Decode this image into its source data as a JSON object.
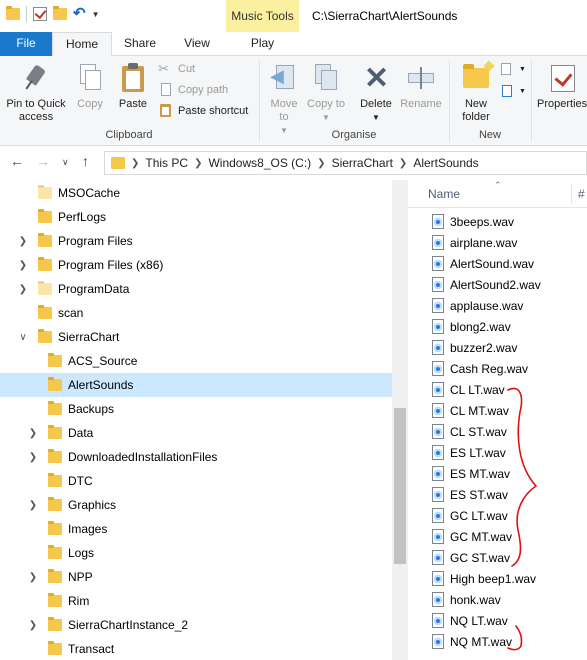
{
  "titlebar": {
    "contextual_tab": "Music Tools",
    "path": "C:\\SierraChart\\AlertSounds",
    "quick_access": [
      "folder-icon",
      "properties-check-icon",
      "folder-icon",
      "undo-icon",
      "customize-dropdown-icon"
    ]
  },
  "tabs": [
    {
      "label": "File"
    },
    {
      "label": "Home"
    },
    {
      "label": "Share"
    },
    {
      "label": "View"
    },
    {
      "label": "Play"
    }
  ],
  "ribbon": {
    "clipboard": {
      "pin_label": "Pin to Quick access",
      "copy_label": "Copy",
      "paste_label": "Paste",
      "cut_label": "Cut",
      "copy_path_label": "Copy path",
      "paste_shortcut_label": "Paste shortcut",
      "group_label": "Clipboard"
    },
    "organise": {
      "move_to_label": "Move to",
      "copy_to_label": "Copy to",
      "delete_label": "Delete",
      "rename_label": "Rename",
      "group_label": "Organise"
    },
    "new": {
      "new_folder_label": "New folder",
      "group_label": "New"
    },
    "open": {
      "properties_label": "Properties"
    }
  },
  "address": {
    "crumbs": [
      "This PC",
      "Windows8_OS (C:)",
      "SierraChart",
      "AlertSounds"
    ]
  },
  "tree": [
    {
      "label": "MSOCache",
      "expandable": false,
      "indent": 0
    },
    {
      "label": "PerfLogs",
      "expandable": false,
      "indent": 0
    },
    {
      "label": "Program Files",
      "expandable": true,
      "indent": 0
    },
    {
      "label": "Program Files (x86)",
      "expandable": true,
      "indent": 0
    },
    {
      "label": "ProgramData",
      "expandable": true,
      "indent": 0
    },
    {
      "label": "scan",
      "expandable": false,
      "indent": 0
    },
    {
      "label": "SierraChart",
      "expandable": "open",
      "indent": 0
    },
    {
      "label": "ACS_Source",
      "expandable": false,
      "indent": 1
    },
    {
      "label": "AlertSounds",
      "expandable": false,
      "indent": 1,
      "selected": true
    },
    {
      "label": "Backups",
      "expandable": false,
      "indent": 1
    },
    {
      "label": "Data",
      "expandable": true,
      "indent": 1
    },
    {
      "label": "DownloadedInstallationFiles",
      "expandable": true,
      "indent": 1
    },
    {
      "label": "DTC",
      "expandable": false,
      "indent": 1
    },
    {
      "label": "Graphics",
      "expandable": true,
      "indent": 1
    },
    {
      "label": "Images",
      "expandable": false,
      "indent": 1
    },
    {
      "label": "Logs",
      "expandable": false,
      "indent": 1
    },
    {
      "label": "NPP",
      "expandable": true,
      "indent": 1
    },
    {
      "label": "Rim",
      "expandable": false,
      "indent": 1
    },
    {
      "label": "SierraChartInstance_2",
      "expandable": true,
      "indent": 1
    },
    {
      "label": "Transact",
      "expandable": false,
      "indent": 1
    }
  ],
  "list": {
    "column_name": "Name",
    "column_num": "#",
    "files": [
      "3beeps.wav",
      "airplane.wav",
      "AlertSound.wav",
      "AlertSound2.wav",
      "applause.wav",
      "blong2.wav",
      "buzzer2.wav",
      "Cash Reg.wav",
      "CL LT.wav",
      "CL MT.wav",
      "CL ST.wav",
      "ES LT.wav",
      "ES MT.wav",
      "ES ST.wav",
      "GC LT.wav",
      "GC MT.wav",
      "GC ST.wav",
      "High beep1.wav",
      "honk.wav",
      "NQ LT.wav",
      "NQ MT.wav"
    ]
  },
  "colors": {
    "file_tab": "#1979ca",
    "contextual": "#fbf0a0",
    "selection": "#cce8ff",
    "annotation": "#e01010"
  }
}
